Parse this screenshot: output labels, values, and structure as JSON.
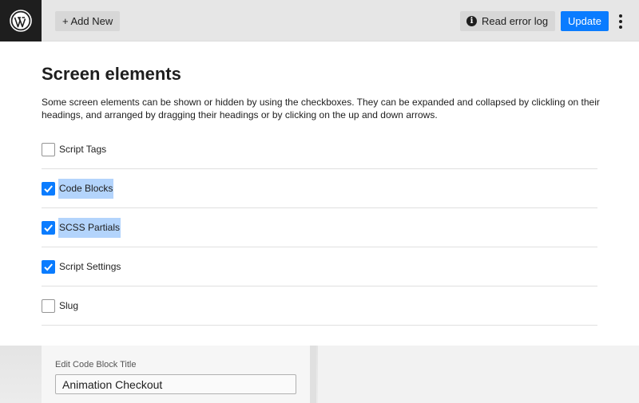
{
  "toolbar": {
    "add_new_label": "+ Add New",
    "error_log_label": "Read error log",
    "update_label": "Update"
  },
  "panel": {
    "title": "Screen elements",
    "description": "Some screen elements can be shown or hidden by using the checkboxes. They can be expanded and collapsed by clickling on their headings, and arranged by dragging their headings or by clicking on the up and down arrows.",
    "options": [
      {
        "label": "Script Tags",
        "checked": false
      },
      {
        "label": "Code Blocks",
        "checked": true
      },
      {
        "label": "SCSS Partials",
        "checked": true
      },
      {
        "label": "Script Settings",
        "checked": true
      },
      {
        "label": "Slug",
        "checked": false
      }
    ]
  },
  "editor": {
    "title_field_label": "Edit Code Block Title",
    "title_field_value": "Animation Checkout"
  },
  "colors": {
    "accent": "#0a7cff",
    "selection_highlight": "#b3d4fc",
    "logo_bg": "#1e1e1e"
  },
  "icons": [
    "wordpress-logo-icon",
    "info-icon",
    "more-vertical-icon",
    "checkmark-icon"
  ]
}
